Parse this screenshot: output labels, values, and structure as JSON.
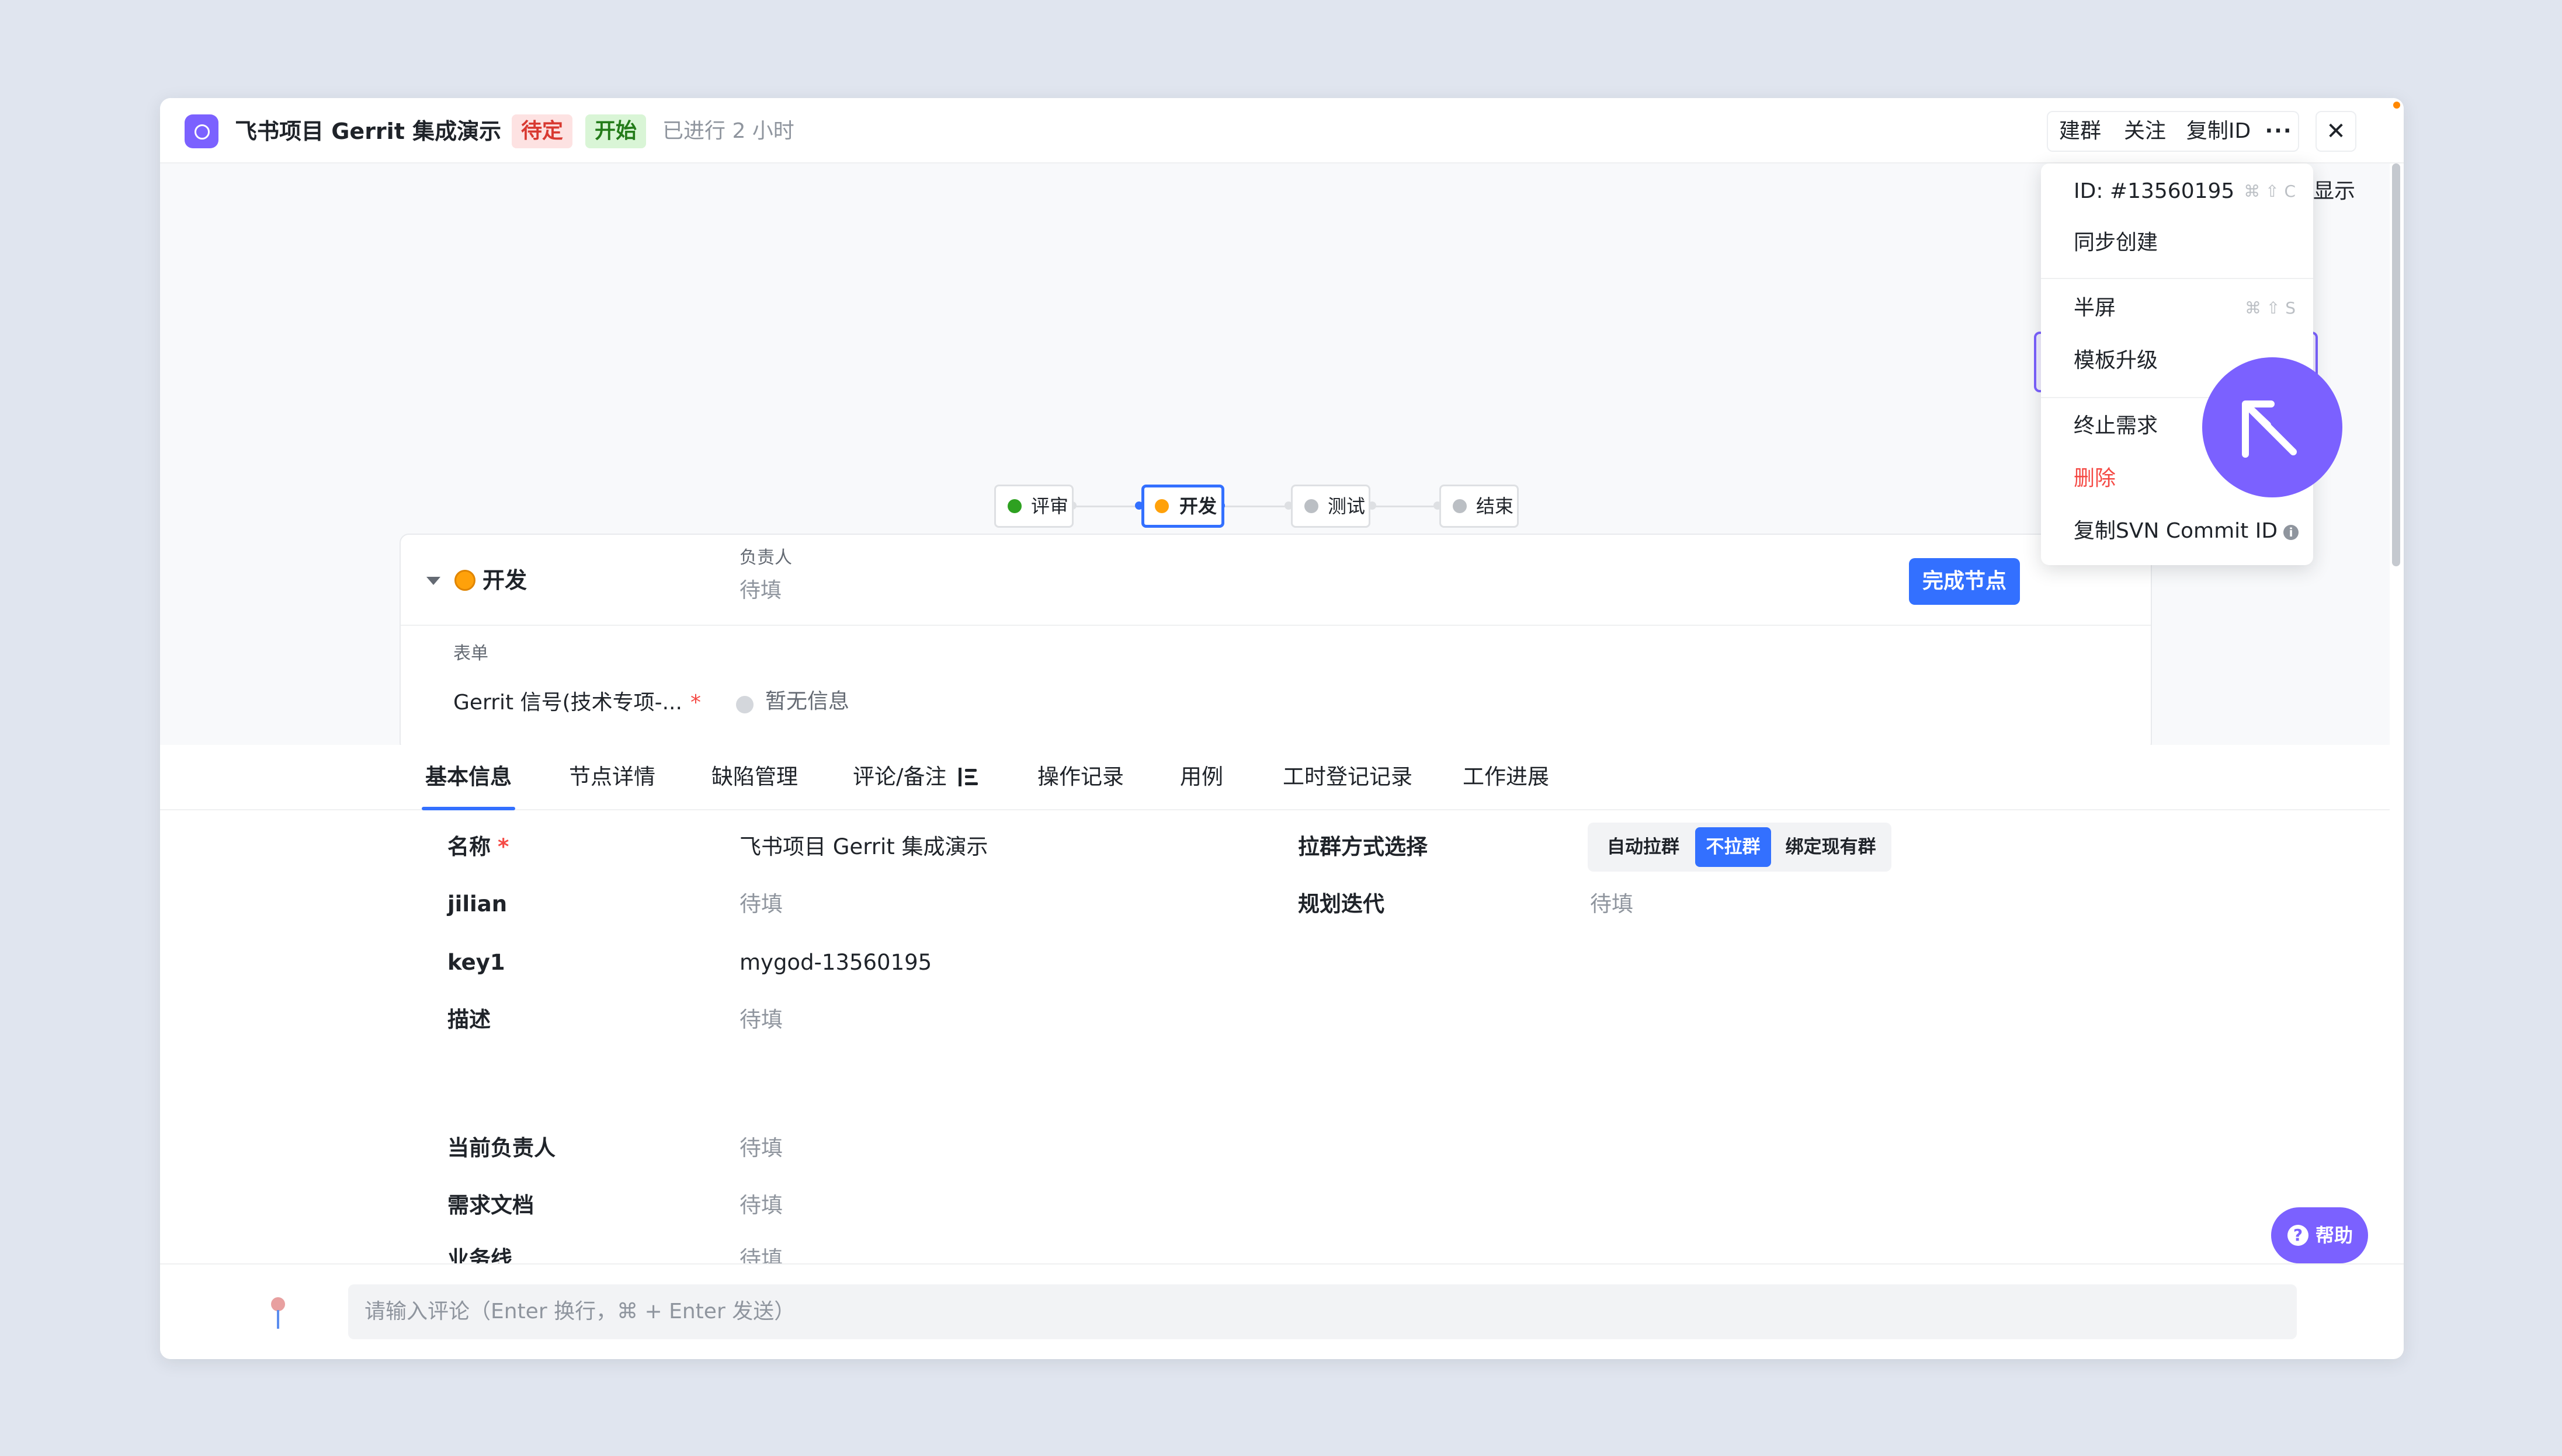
{
  "header": {
    "title": "飞书项目 Gerrit 集成演示",
    "status_tag": "待定",
    "stage_tag": "开始",
    "elapsed": "已进行 2 小时",
    "buttons": {
      "create_group": "建群",
      "follow": "关注",
      "copy_id": "复制ID",
      "more": "···",
      "close": "✕"
    }
  },
  "workflow": {
    "nodes": [
      {
        "label": "评审",
        "color": "#2ea121"
      },
      {
        "label": "开发",
        "color": "#ffa10a"
      },
      {
        "label": "测试",
        "color": "#bbbfc4"
      },
      {
        "label": "结束",
        "color": "#bbbfc4"
      }
    ]
  },
  "node_panel": {
    "name": "开发",
    "owner_label": "负责人",
    "owner_value": "待填",
    "complete_button": "完成节点",
    "form_label": "表单",
    "form_field": "Gerrit 信号(技术专项-...",
    "required_mark": "*",
    "form_value": "暂无信息"
  },
  "tabs": [
    "基本信息",
    "节点详情",
    "缺陷管理",
    "评论/备注",
    "操作记录",
    "用例",
    "工时登记记录",
    "工作进展"
  ],
  "fields": {
    "name_label": "名称",
    "required_mark": "*",
    "name_value": "飞书项目 Gerrit 集成演示",
    "jilian_label": "jilian",
    "jilian_value": "待填",
    "key1_label": "key1",
    "key1_value": "mygod-13560195",
    "desc_label": "描述",
    "desc_value": "待填",
    "owner_label": "当前负责人",
    "owner_value": "待填",
    "doc_label": "需求文档",
    "doc_value": "待填",
    "biz_label": "业务线",
    "biz_value": "待填",
    "group_label": "拉群方式选择",
    "group_options": [
      "自动拉群",
      "不拉群",
      "绑定现有群"
    ],
    "group_selected": "不拉群",
    "iter_label": "规划迭代",
    "iter_value": "待填"
  },
  "comment": {
    "placeholder": "请输入评论（Enter 换行，⌘ + Enter 发送）"
  },
  "help_button": "帮助",
  "help_icon": "?",
  "side_text": "显示",
  "menu": {
    "id": "ID: #13560195",
    "id_shortcut": "⌘ ⇧ C",
    "sync_create": "同步创建",
    "half_screen": "半屏",
    "half_shortcut": "⌘ ⇧ S",
    "template_upgrade": "模板升级",
    "terminate": "终止需求",
    "delete": "删除",
    "copy_svn": "复制SVN Commit ID",
    "info_icon": "i"
  },
  "colors": {
    "accent": "#3370ff",
    "brand": "#7b61ff",
    "danger": "#f54a45"
  }
}
